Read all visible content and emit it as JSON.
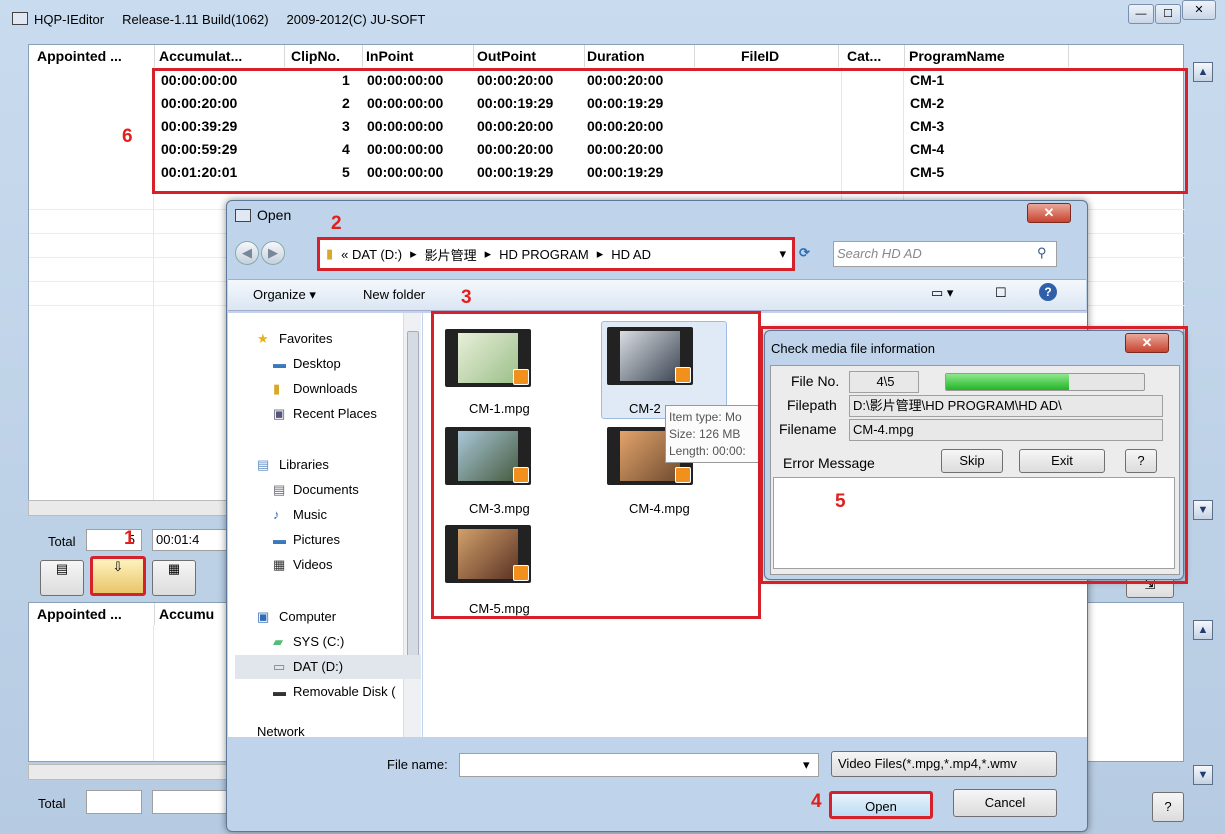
{
  "app": {
    "title": "HQP-IEditor",
    "release": "Release-1.11 Build(1062)",
    "copyright": "2009-2012(C)  JU-SOFT"
  },
  "grid": {
    "headers": [
      "Appointed ...",
      "Accumulat...",
      "ClipNo.",
      "InPoint",
      "OutPoint",
      "Duration",
      "FileID",
      "Cat...",
      "ProgramName"
    ],
    "rows": [
      {
        "acc": "00:00:00:00",
        "clip": "1",
        "in": "00:00:00:00",
        "out": "00:00:20:00",
        "dur": "00:00:20:00",
        "name": "CM-1"
      },
      {
        "acc": "00:00:20:00",
        "clip": "2",
        "in": "00:00:00:00",
        "out": "00:00:19:29",
        "dur": "00:00:19:29",
        "name": "CM-2"
      },
      {
        "acc": "00:00:39:29",
        "clip": "3",
        "in": "00:00:00:00",
        "out": "00:00:20:00",
        "dur": "00:00:20:00",
        "name": "CM-3"
      },
      {
        "acc": "00:00:59:29",
        "clip": "4",
        "in": "00:00:00:00",
        "out": "00:00:20:00",
        "dur": "00:00:20:00",
        "name": "CM-4"
      },
      {
        "acc": "00:01:20:01",
        "clip": "5",
        "in": "00:00:00:00",
        "out": "00:00:19:29",
        "dur": "00:00:19:29",
        "name": "CM-5"
      }
    ]
  },
  "total": {
    "label": "Total",
    "count": "5",
    "duration": "00:01:4"
  },
  "lower_grid": {
    "headers": [
      "Appointed ...",
      "Accumu"
    ]
  },
  "lower_total": {
    "label": "Total"
  },
  "callouts": {
    "n1": "1",
    "n2": "2",
    "n3": "3",
    "n4": "4",
    "n5": "5",
    "n6": "6"
  },
  "open_dialog": {
    "title": "Open",
    "path": [
      "« DAT (D:)",
      "影片管理",
      "HD PROGRAM",
      "HD AD"
    ],
    "search_placeholder": "Search HD AD",
    "organize": "Organize ▾",
    "new_folder": "New folder",
    "nav": {
      "favorites": "Favorites",
      "desktop": "Desktop",
      "downloads": "Downloads",
      "recent": "Recent Places",
      "libraries": "Libraries",
      "documents": "Documents",
      "music": "Music",
      "pictures": "Pictures",
      "videos": "Videos",
      "computer": "Computer",
      "sys": "SYS (C:)",
      "dat": "DAT (D:)",
      "removable": "Removable Disk (",
      "network": "Network"
    },
    "files": [
      "CM-1.mpg",
      "CM-2",
      "CM-3.mpg",
      "CM-4.mpg",
      "CM-5.mpg"
    ],
    "tooltip": {
      "type": "Item type: Mo",
      "size": "Size: 126 MB",
      "length": "Length: 00:00:"
    },
    "filename_label": "File name:",
    "filename_value": "",
    "filter": "Video Files(*.mpg,*.mp4,*.wmv",
    "open": "Open",
    "cancel": "Cancel"
  },
  "check_dialog": {
    "title": "Check media file information",
    "fileno_label": "File No.",
    "fileno": "4\\5",
    "progress": 0.62,
    "filepath_label": "Filepath",
    "filepath": "D:\\影片管理\\HD PROGRAM\\HD AD\\",
    "filename_label": "Filename",
    "filename": "CM-4.mpg",
    "error_label": "Error Message",
    "skip": "Skip",
    "exit": "Exit",
    "help": "?",
    "error_text": ""
  },
  "help_btn": "?"
}
